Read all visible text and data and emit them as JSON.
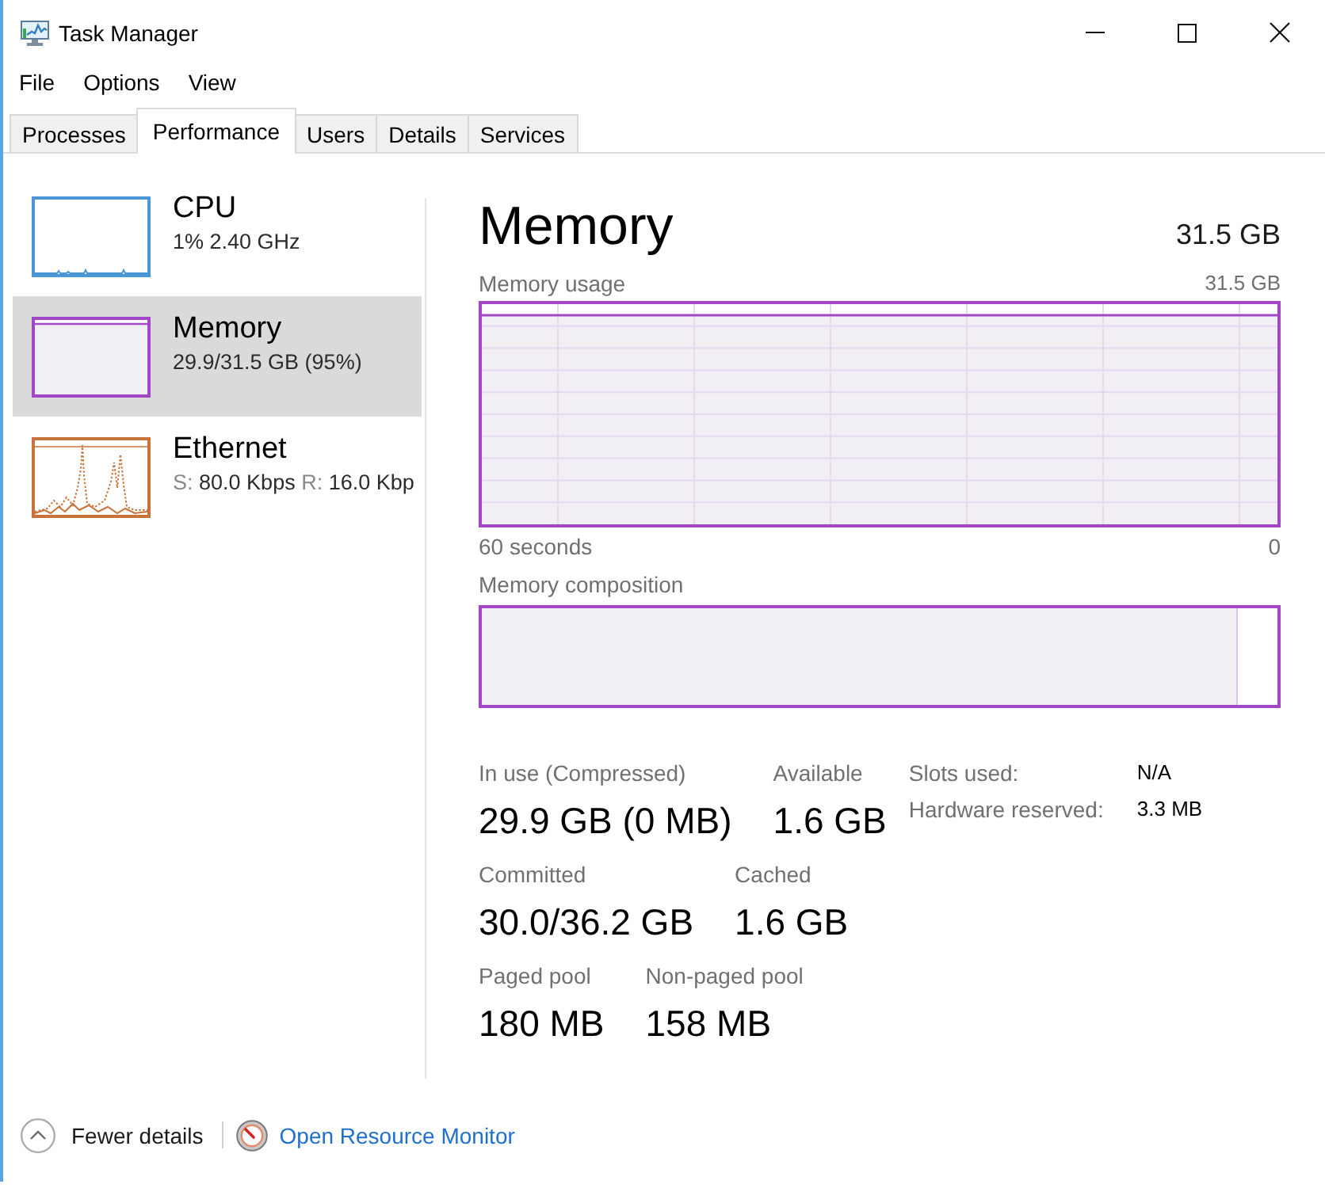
{
  "window": {
    "title": "Task Manager"
  },
  "menu": [
    "File",
    "Options",
    "View"
  ],
  "tabs": [
    {
      "label": "Processes",
      "selected": false
    },
    {
      "label": "Performance",
      "selected": true
    },
    {
      "label": "Users",
      "selected": false
    },
    {
      "label": "Details",
      "selected": false
    },
    {
      "label": "Services",
      "selected": false
    }
  ],
  "sidebar": {
    "items": [
      {
        "kind": "cpu",
        "title": "CPU",
        "subtitle": [
          {
            "value": "1% 2.40 GHz"
          }
        ],
        "color": "#4a96d6",
        "selected": false
      },
      {
        "kind": "memory",
        "title": "Memory",
        "subtitle": [
          {
            "value": "29.9/31.5 GB (95%)"
          }
        ],
        "color": "#a347c9",
        "selected": true
      },
      {
        "kind": "ethernet",
        "title": "Ethernet",
        "subtitle": [
          {
            "label": "S:",
            "value": "80.0 Kbps"
          },
          {
            "label": "R:",
            "value": "16.0 Kbp"
          }
        ],
        "color": "#c8733a",
        "selected": false
      }
    ]
  },
  "main": {
    "title": "Memory",
    "total": "31.5 GB",
    "usage_graph": {
      "label": "Memory usage",
      "max": "31.5 GB",
      "time_span": "60 seconds",
      "end": "0"
    },
    "composition": {
      "label": "Memory composition",
      "level": 0.95
    },
    "stats": [
      [
        {
          "label": "In use (Compressed)",
          "value": "29.9 GB (0 MB)"
        },
        {
          "label": "Available",
          "value": "1.6 GB"
        }
      ],
      [
        {
          "label": "Committed",
          "value": "30.0/36.2 GB"
        },
        {
          "label": "Cached",
          "value": "1.6 GB"
        }
      ],
      [
        {
          "label": "Paged pool",
          "value": "180 MB"
        },
        {
          "label": "Non-paged pool",
          "value": "158 MB"
        }
      ]
    ],
    "details": [
      {
        "label": "Slots used:",
        "value": "N/A"
      },
      {
        "label": "Hardware reserved:",
        "value": "3.3 MB"
      }
    ]
  },
  "footer": {
    "fewer_details": "Fewer details",
    "link": "Open Resource Monitor"
  }
}
